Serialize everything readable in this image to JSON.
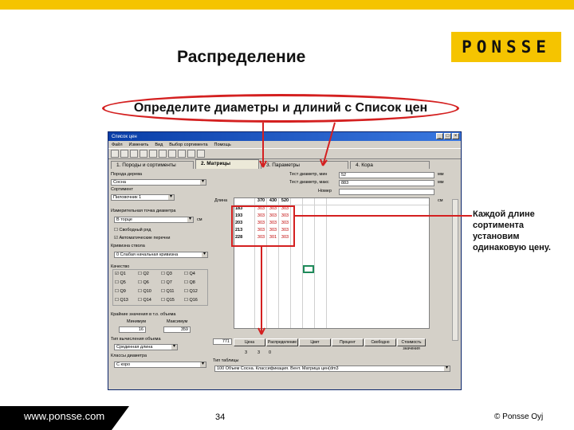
{
  "slide": {
    "title": "Распределение",
    "callout": "Определите диаметры и длиний с Список цен",
    "annotation": "Каждой длине сортимента установим одинаковую цену.",
    "brand": "PONSSE",
    "footer": {
      "url": "www.ponsse.com",
      "page": "34",
      "copyright": "© Ponsse Oyj"
    },
    "colors": {
      "accent_yellow": "#f5c400",
      "callout_red": "#d42020"
    }
  },
  "window": {
    "title": "Список цен",
    "menu": [
      "Файл",
      "Изменить",
      "Вид",
      "Выбор сортимента",
      "Помощь"
    ],
    "tabs": [
      "1. Породы и сортименты",
      "2. Матрицы",
      "3. Параметры",
      "4. Кора"
    ],
    "left": {
      "species_label": "Порода дерева",
      "species_value": "Сосна",
      "assortment_label": "Сортимент",
      "assortment_value": "Пиловочник 1",
      "measure_label": "Измерительная точка диаметра",
      "measure_value": "В торце",
      "measure_unit": "см",
      "free_row": "Свободный ряд",
      "auto_lengths": "Автоматические перечни",
      "curve_label": "Кривизна ствола",
      "curve_value": "0 Слабая начальная кривизна",
      "quality_label": "Качество",
      "qualities": [
        "Q1",
        "Q2",
        "Q3",
        "Q4",
        "Q5",
        "Q6",
        "Q7",
        "Q8",
        "Q9",
        "Q10",
        "Q11",
        "Q12",
        "Q13",
        "Q14",
        "Q15",
        "Q16"
      ],
      "limits_label": "Крайние значения в т.о. объема",
      "min_label": "Минимум",
      "max_label": "Максимум",
      "min_value": "16",
      "max_value": "359",
      "volume_label": "Тип вычисления объема",
      "volume_value": "Срединная длина",
      "class_label": "Классы диаметра",
      "class_value": "С коро"
    },
    "right": {
      "top_diam_label": "Тест диаметр, мин",
      "top_diam_value": "52",
      "top_diam_unit": "мм",
      "butt_diam_label": "Тест диаметр, макс",
      "butt_diam_value": "883",
      "butt_diam_unit": "мм",
      "number_label": "Номер",
      "length_label": "Длина",
      "length_unit": "см",
      "grid_header": [
        "370",
        "430",
        "520"
      ],
      "grid_rows": [
        {
          "label": "183",
          "cells": [
            "303",
            "303",
            "303"
          ]
        },
        {
          "label": "193",
          "cells": [
            "303",
            "303",
            "303"
          ]
        },
        {
          "label": "203",
          "cells": [
            "303",
            "303",
            "303"
          ]
        },
        {
          "label": "213",
          "cells": [
            "303",
            "303",
            "303"
          ]
        },
        {
          "label": "228",
          "cells": [
            "303",
            "301",
            "303"
          ]
        }
      ],
      "side_value": "771",
      "buttons": [
        "Цена",
        "Распределение",
        "Цвет",
        "Процент",
        "Свободно",
        "Стоимость значения"
      ],
      "bottom_values": [
        "3",
        "3",
        "0"
      ],
      "table_type_label": "Тип таблицы",
      "table_type_value": "100 Объем Сосна. Классификация. Вент. Матрица цен(dm3"
    }
  }
}
